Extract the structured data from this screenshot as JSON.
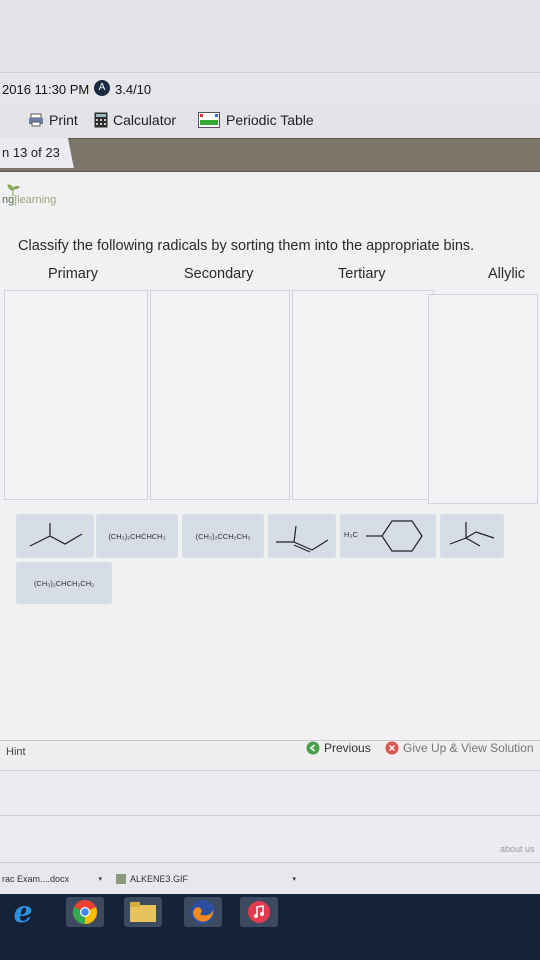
{
  "status_bar": {
    "datetime": "2016 11:30 PM",
    "badge": "A",
    "score": "3.4/10"
  },
  "toolbar": {
    "print": "Print",
    "calculator": "Calculator",
    "periodic_table": "Periodic Table"
  },
  "question_counter": "n 13 of 23",
  "brand": {
    "left": "ng",
    "right": "learning"
  },
  "prompt": "Classify the following radicals by sorting them into the appropriate bins.",
  "bins": [
    "Primary",
    "Secondary",
    "Tertiary",
    "Allylic"
  ],
  "tiles": {
    "t2": "(CH₃)₂CHĊHCH₃",
    "t3": "(CH₃)₂ĊCH₂CH₃",
    "t5_sub": "H₃C",
    "t7": "(CH₃)₂CHCH₂ĊH₂"
  },
  "footer": {
    "hint": "Hint",
    "previous": "Previous",
    "give_up": "Give Up & View Solution",
    "about": "about us"
  },
  "downloads": [
    "rac Exam....docx",
    "ALKENE3.GIF"
  ],
  "colors": {
    "nav_strip": "#7b7669",
    "tile_bg": "#d6dde6",
    "previous_icon": "#4aa04a",
    "give_up_icon": "#d9534f",
    "taskbar": "#15233a"
  }
}
